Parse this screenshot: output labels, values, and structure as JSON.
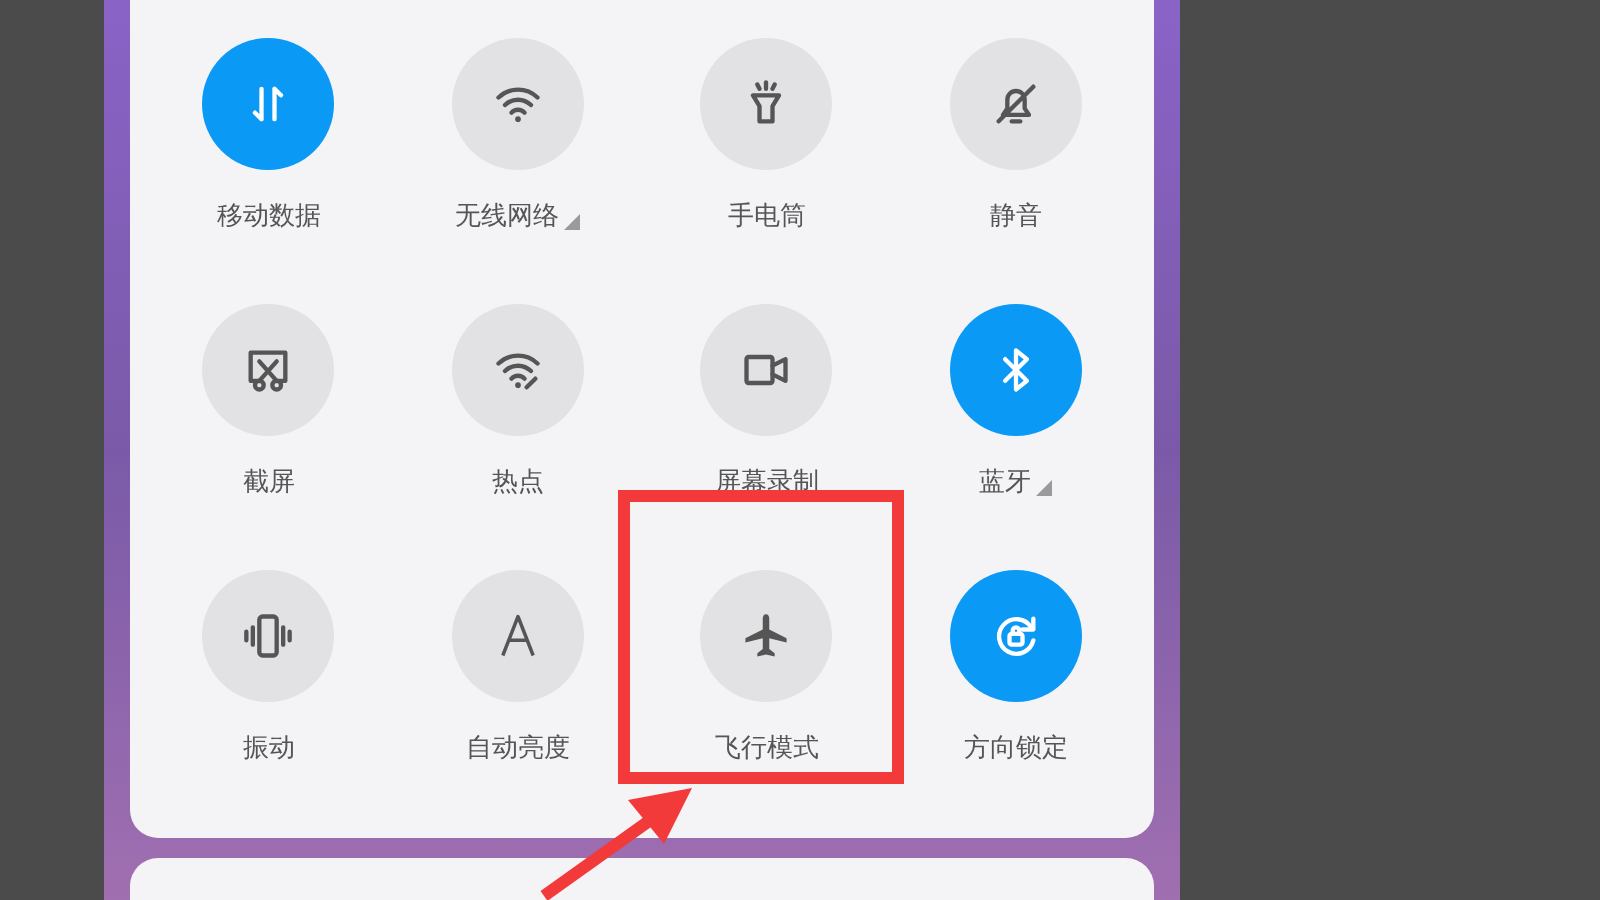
{
  "tiles": [
    {
      "label": "移动数据",
      "on": true,
      "expandable": false,
      "highlighted": false
    },
    {
      "label": "无线网络",
      "on": false,
      "expandable": true,
      "highlighted": false
    },
    {
      "label": "手电筒",
      "on": false,
      "expandable": false,
      "highlighted": false
    },
    {
      "label": "静音",
      "on": false,
      "expandable": false,
      "highlighted": false
    },
    {
      "label": "截屏",
      "on": false,
      "expandable": false,
      "highlighted": false
    },
    {
      "label": "热点",
      "on": false,
      "expandable": false,
      "highlighted": false
    },
    {
      "label": "屏幕录制",
      "on": false,
      "expandable": false,
      "highlighted": false
    },
    {
      "label": "蓝牙",
      "on": true,
      "expandable": true,
      "highlighted": false
    },
    {
      "label": "振动",
      "on": false,
      "expandable": false,
      "highlighted": false
    },
    {
      "label": "自动亮度",
      "on": false,
      "expandable": false,
      "highlighted": false
    },
    {
      "label": "飞行模式",
      "on": false,
      "expandable": false,
      "highlighted": true
    },
    {
      "label": "方向锁定",
      "on": true,
      "expandable": false,
      "highlighted": false
    }
  ]
}
